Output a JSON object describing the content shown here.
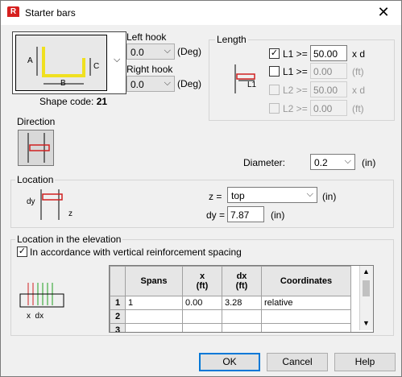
{
  "window": {
    "title": "Starter bars",
    "close_glyph": "✕"
  },
  "shape": {
    "code_label": "Shape code:",
    "code_value": "21",
    "dim_a": "A",
    "dim_b": "B",
    "dim_c": "C"
  },
  "hooks": {
    "left_label": "Left hook",
    "left_value": "0.0",
    "left_unit": "(Deg)",
    "right_label": "Right hook",
    "right_value": "0.0",
    "right_unit": "(Deg)"
  },
  "length": {
    "group_label": "Length",
    "image_label": "L1",
    "rows": [
      {
        "label": "L1 >=",
        "value": "50.00",
        "unit": "x d",
        "checked": "✓"
      },
      {
        "label": "L1 >=",
        "value": "0.00",
        "unit": "(ft)",
        "checked": ""
      },
      {
        "label": "L2 >=",
        "value": "50.00",
        "unit": "x d",
        "checked": ""
      },
      {
        "label": "L2 >=",
        "value": "0.00",
        "unit": "(ft)",
        "checked": ""
      }
    ]
  },
  "direction": {
    "label": "Direction"
  },
  "diameter": {
    "label": "Diameter:",
    "value": "0.2",
    "unit": "(in)"
  },
  "location": {
    "group_label": "Location",
    "img_dy": "dy",
    "img_z": "z",
    "z_label": "z =",
    "z_value": "top",
    "z_unit": "(in)",
    "dy_label": "dy =",
    "dy_value": "7.87",
    "dy_unit": "(in)"
  },
  "elevation": {
    "group_label": "Location in the elevation",
    "checkbox_label": "In accordance with vertical reinforcement spacing",
    "checkbox_glyph": "✓",
    "img_label": "x  dx",
    "table": {
      "headers": [
        "Spans",
        "x\n(ft)",
        "dx\n(ft)",
        "Coordinates"
      ],
      "rows": [
        {
          "num": "1",
          "spans": "1",
          "x": "0.00",
          "dx": "3.28",
          "coord": "relative"
        },
        {
          "num": "2",
          "spans": "",
          "x": "",
          "dx": "",
          "coord": ""
        },
        {
          "num": "3",
          "spans": "",
          "x": "",
          "dx": "",
          "coord": ""
        }
      ]
    }
  },
  "buttons": {
    "ok": "OK",
    "cancel": "Cancel",
    "help": "Help"
  },
  "icons": {
    "dropdown": "chevron-down-icon",
    "close": "close-icon",
    "app": "robot-app-icon"
  },
  "colors": {
    "accent": "#0078d7",
    "bar_yellow": "#f0e020",
    "bar_red": "#d02020"
  }
}
